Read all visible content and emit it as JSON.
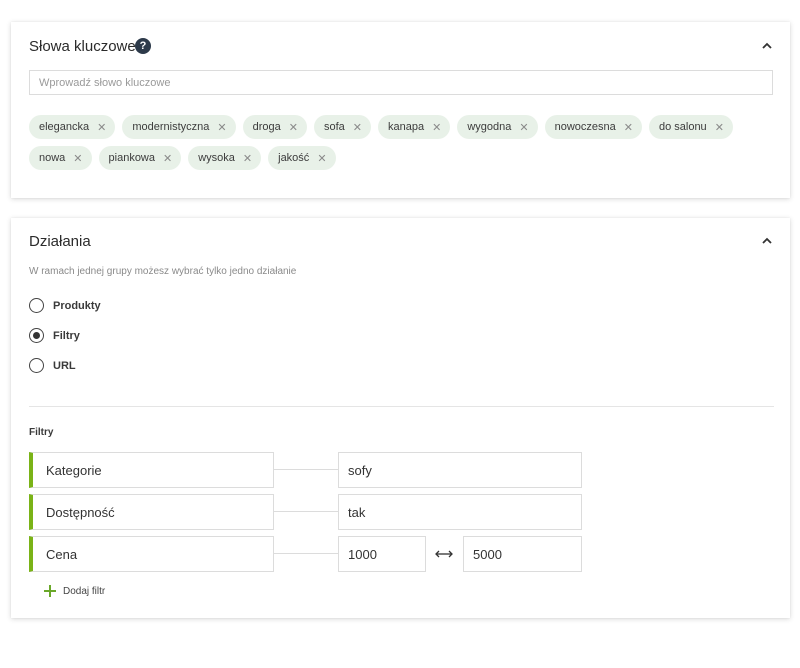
{
  "keywords_section": {
    "title": "Słowa kluczowe",
    "help_icon": "question-circle-icon",
    "collapse_icon": "chevron-up-icon",
    "input": {
      "placeholder": "Wprowadź słowo kluczowe",
      "value": ""
    },
    "tags": [
      "elegancka",
      "modernistyczna",
      "droga",
      "sofa",
      "kanapa",
      "wygodna",
      "nowoczesna",
      "do salonu",
      "nowa",
      "piankowa",
      "wysoka",
      "jakość"
    ],
    "remove_icon": "close-icon",
    "tag_color": "#e8f1e8"
  },
  "actions_section": {
    "title": "Działania",
    "collapse_icon": "chevron-up-icon",
    "hint": "W ramach jednej grupy możesz wybrać tylko jedno działanie",
    "options": [
      {
        "label": "Produkty",
        "selected": false
      },
      {
        "label": "Filtry",
        "selected": true
      },
      {
        "label": "URL",
        "selected": false
      }
    ],
    "filters_heading": "Filtry",
    "filters": [
      {
        "name": "Kategorie",
        "value": "sofy"
      },
      {
        "name": "Dostępność",
        "value": "tak"
      },
      {
        "name": "Cena",
        "min": "1000",
        "max": "5000"
      }
    ],
    "range_icon": "double-arrow-horizontal-icon",
    "add_filter_label": "Dodaj filtr",
    "add_icon": "plus-icon",
    "accent_color": "#7ab317"
  }
}
